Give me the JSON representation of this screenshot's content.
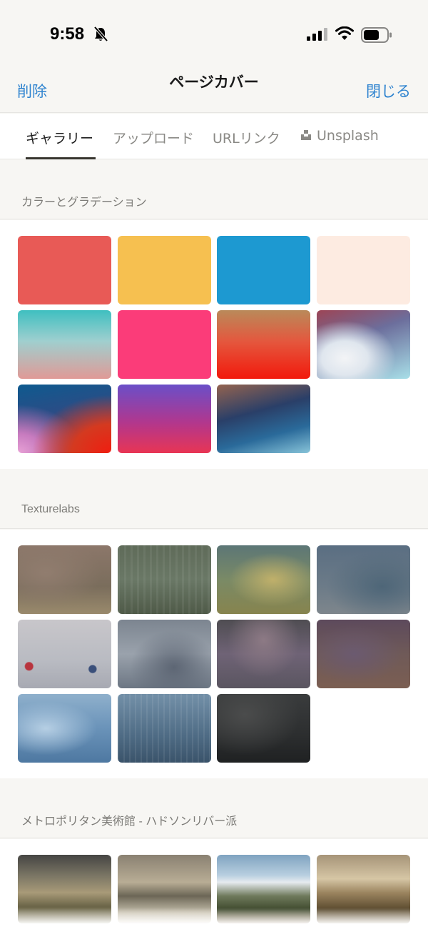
{
  "status": {
    "time": "9:58"
  },
  "header": {
    "delete_label": "削除",
    "title": "ページカバー",
    "close_label": "閉じる"
  },
  "tabs": [
    {
      "label": "ギャラリー"
    },
    {
      "label": "アップロード"
    },
    {
      "label": "URLリンク"
    },
    {
      "label": "Unsplash"
    }
  ],
  "sections": [
    {
      "label": "カラーとグラデーション"
    },
    {
      "label": "Texturelabs"
    },
    {
      "label": "メトロポリタン美術館 - ハドソンリバー派"
    }
  ],
  "colors": {
    "accent_blue": "#2e83cf",
    "swatch_red": "#e85a56",
    "swatch_yellow": "#f6c050",
    "swatch_blue": "#1d99d1",
    "swatch_cream": "#fdebe1"
  }
}
